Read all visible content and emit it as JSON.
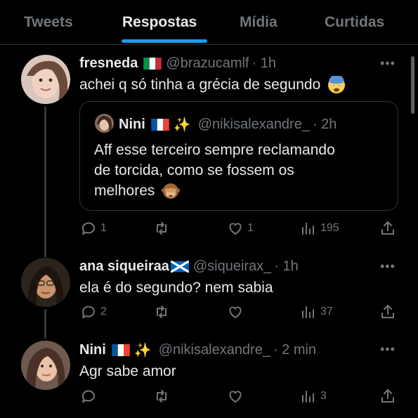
{
  "tabs": [
    {
      "label": "Tweets"
    },
    {
      "label": "Respostas"
    },
    {
      "label": "Mídia"
    },
    {
      "label": "Curtidas"
    }
  ],
  "posts": [
    {
      "name": "fresneda",
      "flag": "italy",
      "handle": "@brazucamlf",
      "time": "· 1h",
      "text": "achei q só tinha a grécia de segundo",
      "emoji": "fearful-face",
      "stats": {
        "replies": "1",
        "retweets": "",
        "likes": "1",
        "views": "195"
      },
      "quote": {
        "name": "Nini",
        "flag": "france",
        "handle": "@nikisalexandre_",
        "time": "· 2h",
        "lines": [
          "Aff esse terceiro sempre reclamando",
          "de torcida, como se fossem os",
          "melhores"
        ],
        "emoji": "see-no-evil-monkey"
      }
    },
    {
      "name": "ana siqueiraa",
      "flag": "scotland",
      "handle": "@siqueirax_",
      "time": "· 1h",
      "text": "ela é do segundo? nem sabia",
      "stats": {
        "replies": "2",
        "retweets": "",
        "likes": "",
        "views": "37"
      }
    },
    {
      "name": "Nini",
      "flag": "france",
      "handle": "@nikisalexandre_",
      "time": "· 2 min",
      "text": "Agr sabe amor",
      "stats": {
        "replies": "",
        "retweets": "",
        "likes": "",
        "views": "3"
      }
    }
  ],
  "more_glyph": "•••",
  "colors": {
    "accent": "#1d9bf0",
    "muted": "#71767b",
    "text": "#e7e9ea",
    "background": "#000000"
  }
}
